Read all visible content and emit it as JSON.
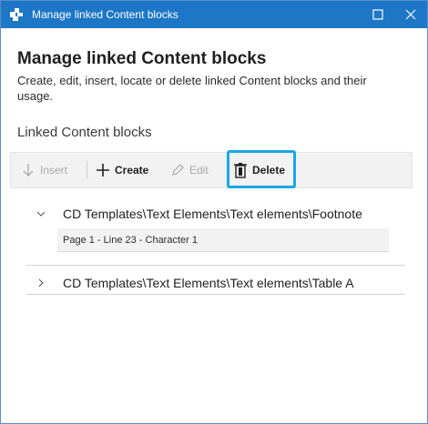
{
  "window": {
    "title": "Manage linked Content blocks",
    "accent_color": "#1d77c6",
    "maximize_icon": "maximize-icon",
    "close_icon": "close-icon"
  },
  "header": {
    "title": "Manage linked Content blocks",
    "description": "Create, edit, insert, locate or delete linked Content blocks and their usage."
  },
  "section": {
    "label": "Linked Content blocks"
  },
  "toolbar": {
    "insert_label": "Insert",
    "create_label": "Create",
    "edit_label": "Edit",
    "delete_label": "Delete",
    "highlight_color": "#1aa7e6"
  },
  "tree": {
    "items": [
      {
        "label": "CD Templates\\Text Elements\\Text elements\\Footnote",
        "expanded": true,
        "children": [
          "Page 1 - Line 23 - Character 1"
        ]
      },
      {
        "label": "CD Templates\\Text Elements\\Text elements\\Table A",
        "expanded": false,
        "children": []
      }
    ]
  }
}
